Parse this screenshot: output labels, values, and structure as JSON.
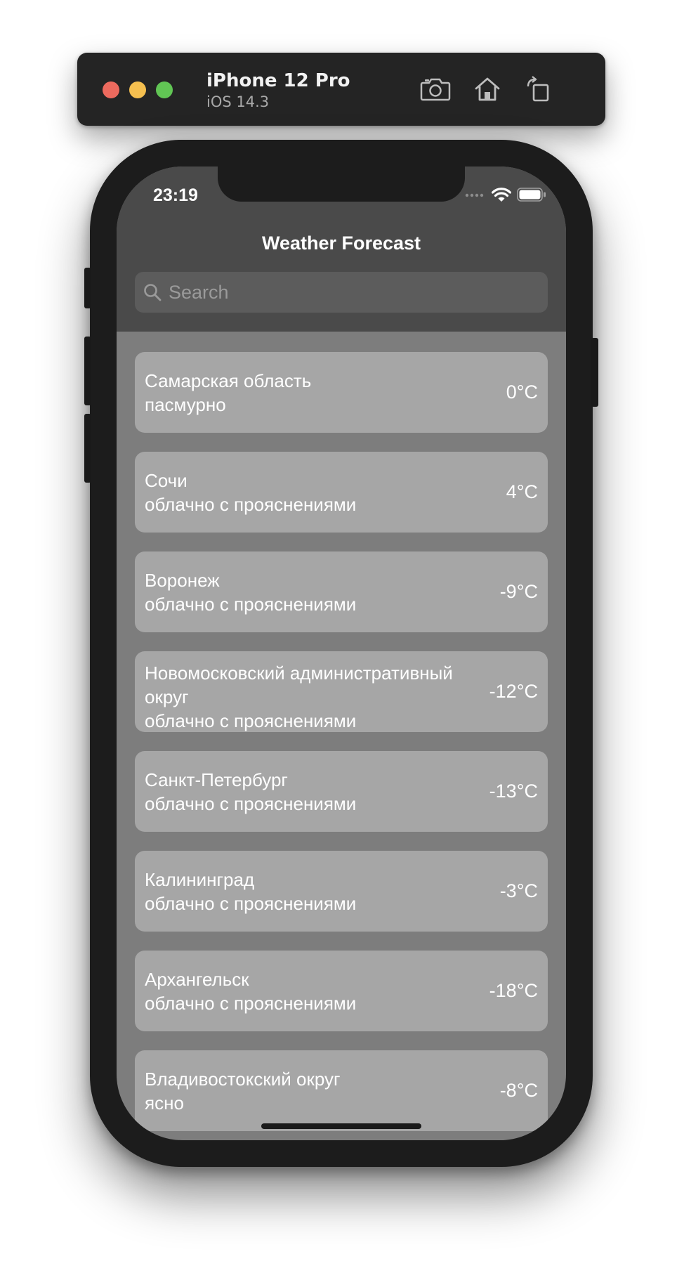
{
  "simulator": {
    "device_name": "iPhone 12 Pro",
    "os_version": "iOS 14.3",
    "buttons": [
      {
        "icon": "camera-icon"
      },
      {
        "icon": "home-icon"
      },
      {
        "icon": "rotate-icon"
      }
    ],
    "traffic_lights": {
      "close": "#ed6a5e",
      "minimize": "#f5bf4f",
      "zoom": "#61c554"
    }
  },
  "status_bar": {
    "time": "23:19"
  },
  "nav": {
    "title": "Weather Forecast"
  },
  "search": {
    "placeholder": "Search",
    "value": ""
  },
  "forecast": [
    {
      "city": "Самарская область",
      "condition": "пасмурно",
      "temperature": "0°C"
    },
    {
      "city": "Сочи",
      "condition": "облачно с прояснениями",
      "temperature": "4°C"
    },
    {
      "city": "Воронеж",
      "condition": "облачно с прояснениями",
      "temperature": "-9°C"
    },
    {
      "city": "Новомосковский административный округ",
      "condition": "облачно с прояснениями",
      "temperature": "-12°C"
    },
    {
      "city": "Санкт-Петербург",
      "condition": "облачно с прояснениями",
      "temperature": "-13°C"
    },
    {
      "city": "Калининград",
      "condition": "облачно с прояснениями",
      "temperature": "-3°C"
    },
    {
      "city": "Архангельск",
      "condition": "облачно с прояснениями",
      "temperature": "-18°C"
    },
    {
      "city": "Владивостокский округ",
      "condition": "ясно",
      "temperature": "-8°C"
    }
  ],
  "colors": {
    "header_bg": "#4a4a4a",
    "list_bg": "#7d7d7d",
    "card_bg": "#a6a6a6",
    "text": "#ffffff"
  }
}
